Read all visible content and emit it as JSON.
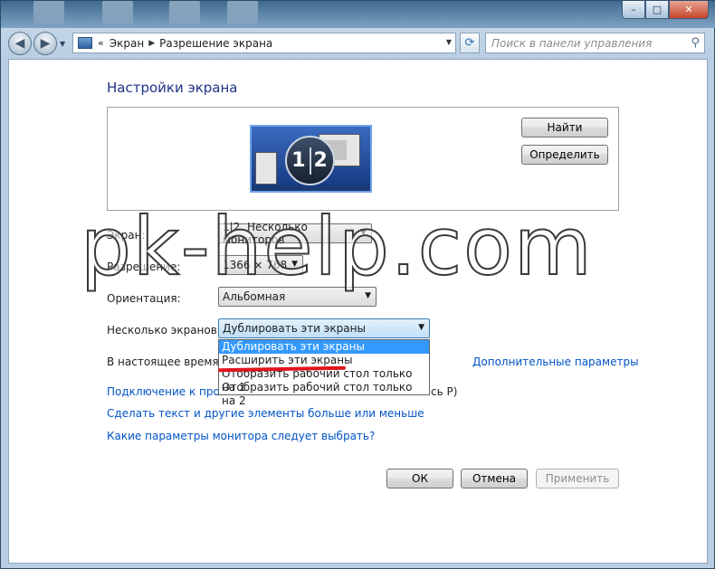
{
  "window": {
    "controls": {
      "minimize": "–",
      "maximize": "□",
      "close": "✕"
    }
  },
  "address_bar": {
    "chevron": "«",
    "crumbs": [
      "Экран",
      "Разрешение экрана"
    ],
    "separator": "▶",
    "search_placeholder": "Поиск в панели управления"
  },
  "page": {
    "title": "Настройки экрана",
    "monitor_badge": [
      "1",
      "2"
    ],
    "buttons": {
      "find": "Найти",
      "identify": "Определить"
    }
  },
  "fields": {
    "display": {
      "label": "Экран:",
      "value": "1|2. Несколько мониторов"
    },
    "resolution": {
      "label": "Разрешение:",
      "value": "1366 × 768"
    },
    "orientation": {
      "label": "Ориентация:",
      "value": "Альбомная"
    },
    "multiple": {
      "label": "Несколько экранов:",
      "value": "Дублировать эти экраны",
      "options": [
        "Дублировать эти экраны",
        "Расширить эти экраны",
        "Отобразить рабочий стол только на 1",
        "Отобразить рабочий стол только на 2"
      ],
      "selected_index": 0
    }
  },
  "info_text": "В настоящее время эт",
  "links": {
    "advanced": "Дополнительные параметры",
    "projector": "Подключение к проек",
    "projector_tail": "сь P)",
    "text_size": "Сделать текст и другие элементы больше или меньше",
    "which_settings": "Какие параметры монитора следует выбрать?"
  },
  "footer_buttons": {
    "ok": "ОК",
    "cancel": "Отмена",
    "apply": "Применить"
  },
  "watermark": "pk-help.com"
}
